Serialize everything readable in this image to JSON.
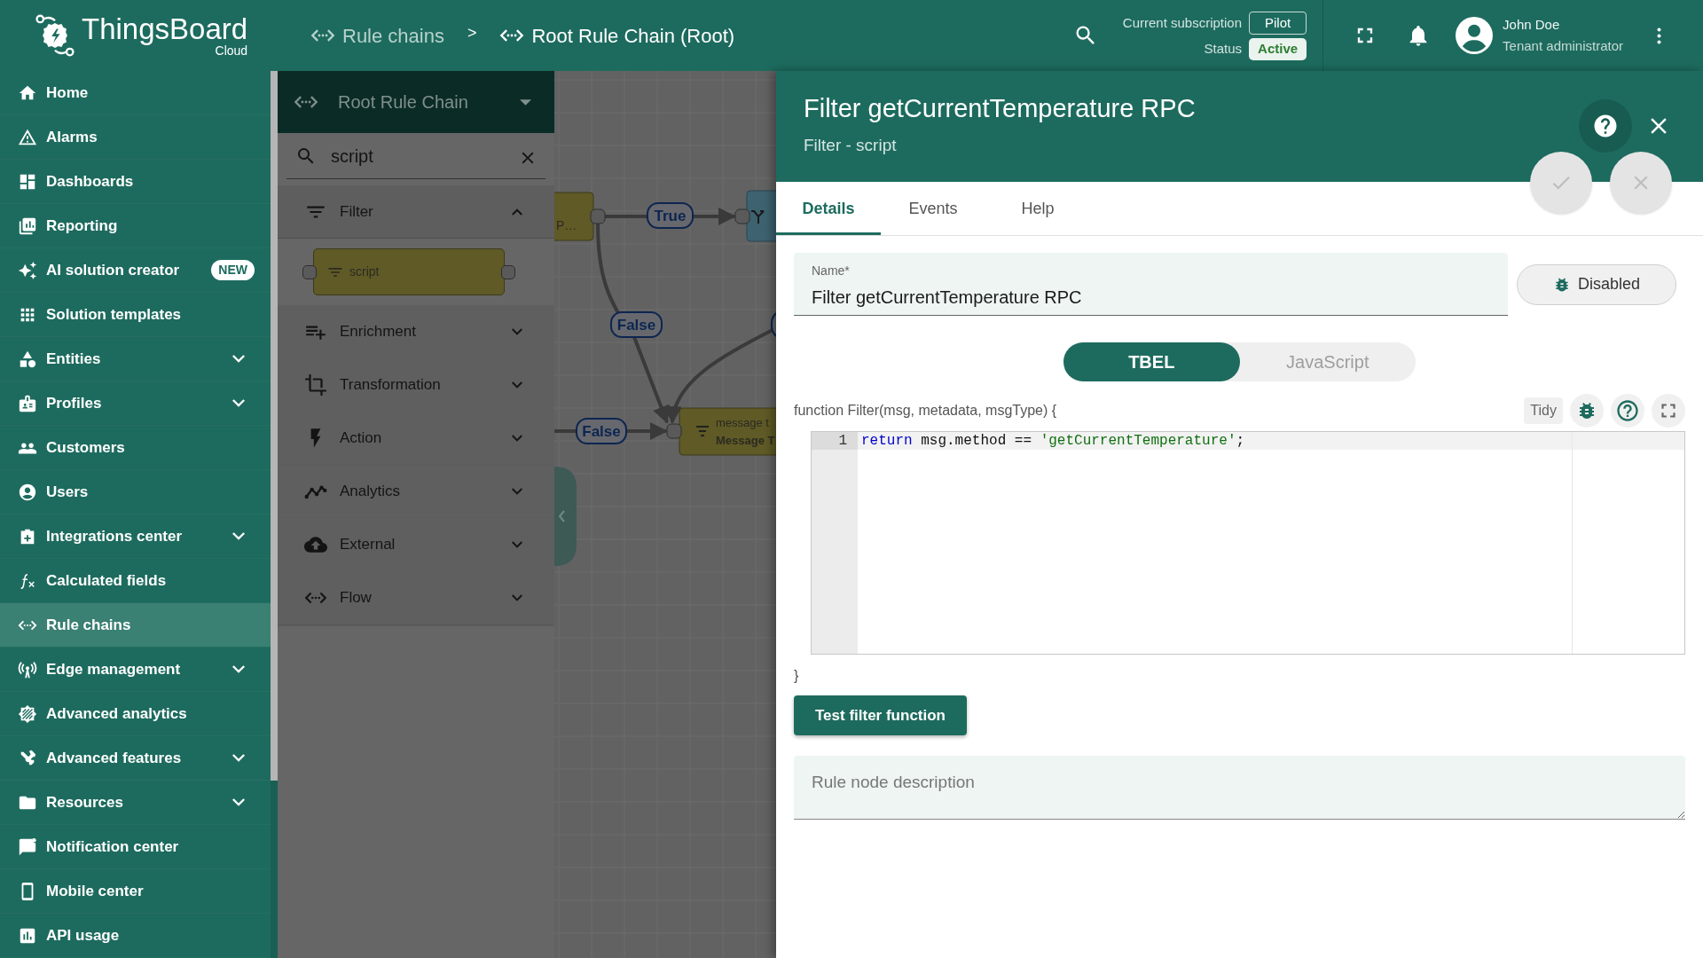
{
  "top_bar": {
    "logo": {
      "name": "ThingsBoard",
      "edition": "Cloud"
    },
    "breadcrumbs": [
      {
        "label": "Rule chains",
        "current": false
      },
      {
        "label": "Root Rule Chain (Root)",
        "current": true
      }
    ],
    "breadcrumb_separator": ">",
    "subscription": {
      "label": "Current subscription",
      "plan": "Pilot",
      "status_label": "Status",
      "status": "Active"
    },
    "user": {
      "name": "John Doe",
      "role": "Tenant administrator"
    }
  },
  "sidebar": {
    "items": [
      {
        "label": "Home",
        "expandable": false,
        "selected": false
      },
      {
        "label": "Alarms",
        "expandable": false,
        "selected": false
      },
      {
        "label": "Dashboards",
        "expandable": false,
        "selected": false
      },
      {
        "label": "Reporting",
        "expandable": false,
        "selected": false
      },
      {
        "label": "AI solution creator",
        "expandable": false,
        "selected": false,
        "badge": "NEW"
      },
      {
        "label": "Solution templates",
        "expandable": false,
        "selected": false
      },
      {
        "label": "Entities",
        "expandable": true,
        "selected": false
      },
      {
        "label": "Profiles",
        "expandable": true,
        "selected": false
      },
      {
        "label": "Customers",
        "expandable": false,
        "selected": false
      },
      {
        "label": "Users",
        "expandable": false,
        "selected": false
      },
      {
        "label": "Integrations center",
        "expandable": true,
        "selected": false
      },
      {
        "label": "Calculated fields",
        "expandable": false,
        "selected": false
      },
      {
        "label": "Rule chains",
        "expandable": false,
        "selected": true
      },
      {
        "label": "Edge management",
        "expandable": true,
        "selected": false
      },
      {
        "label": "Advanced analytics",
        "expandable": false,
        "selected": false
      },
      {
        "label": "Advanced features",
        "expandable": true,
        "selected": false
      },
      {
        "label": "Resources",
        "expandable": true,
        "selected": false
      },
      {
        "label": "Notification center",
        "expandable": false,
        "selected": false
      },
      {
        "label": "Mobile center",
        "expandable": false,
        "selected": false
      },
      {
        "label": "API usage",
        "expandable": false,
        "selected": false
      }
    ]
  },
  "palette": {
    "title": "Root Rule Chain",
    "search": {
      "value": "script"
    },
    "categories": [
      {
        "label": "Filter",
        "expanded": true,
        "nodes": [
          {
            "label": "script"
          }
        ]
      },
      {
        "label": "Enrichment",
        "expanded": false
      },
      {
        "label": "Transformation",
        "expanded": false
      },
      {
        "label": "Action",
        "expanded": false
      },
      {
        "label": "Analytics",
        "expanded": false
      },
      {
        "label": "External",
        "expanded": false
      },
      {
        "label": "Flow",
        "expanded": false
      }
    ]
  },
  "canvas": {
    "nodes": [
      {
        "lines": [
          "P…"
        ]
      },
      {
        "lines": [
          "message t",
          "Message T"
        ]
      }
    ],
    "links": [
      {
        "label": "True"
      },
      {
        "label": "False"
      },
      {
        "label": "False"
      }
    ]
  },
  "panel": {
    "title": "Filter getCurrentTemperature RPC",
    "subtitle": "Filter - script",
    "tabs": [
      {
        "label": "Details",
        "selected": true
      },
      {
        "label": "Events",
        "selected": false
      },
      {
        "label": "Help",
        "selected": false
      }
    ],
    "name_field": {
      "label": "Name*",
      "value": "Filter getCurrentTemperature RPC"
    },
    "debug_button": "Disabled",
    "languages": [
      {
        "label": "TBEL",
        "selected": true
      },
      {
        "label": "JavaScript",
        "selected": false
      }
    ],
    "function_header": "function Filter(msg, metadata, msgType) {",
    "editor_tool": "Tidy",
    "code_lines": [
      {
        "number": "1",
        "tokens": [
          {
            "kind": "keyword",
            "text": "return"
          },
          {
            "kind": "plain",
            "text": " msg.method == "
          },
          {
            "kind": "string",
            "text": "'getCurrentTemperature'"
          },
          {
            "kind": "plain",
            "text": ";"
          }
        ]
      }
    ],
    "function_footer": "}",
    "test_button": "Test filter function",
    "description": {
      "placeholder": "Rule node description"
    }
  }
}
